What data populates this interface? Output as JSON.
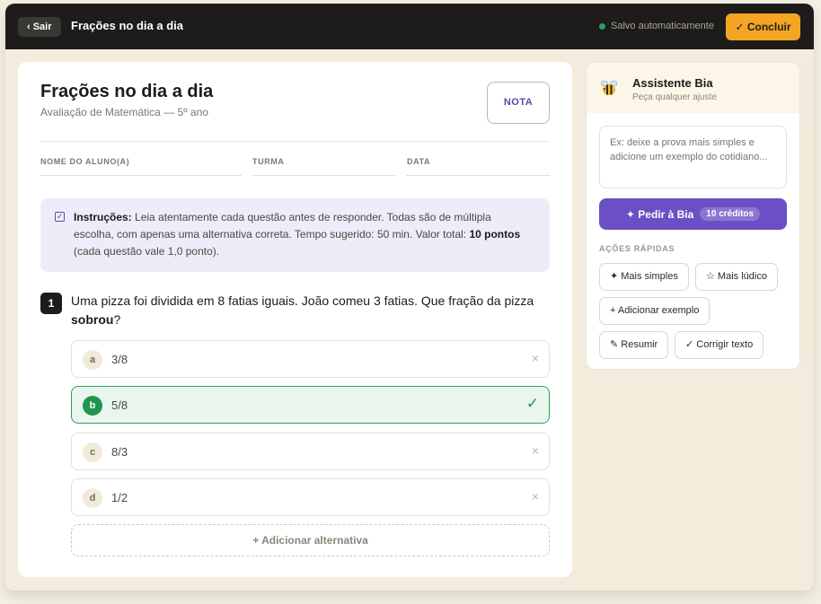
{
  "topbar": {
    "exit_label": "‹ Sair",
    "title": "Frações no dia a dia",
    "saved_status": "Salvo automaticamente",
    "finish_label": "✓ Concluir"
  },
  "document": {
    "title": "Frações no dia a dia",
    "subtitle": "Avaliação de Matemática — 5º ano",
    "grade_label": "NOTA",
    "fields": [
      "NOME DO ALUNO(A)",
      "TURMA",
      "DATA"
    ],
    "instructions": {
      "label": "Instruções:",
      "text": " Leia atentamente cada questão antes de responder. Todas são de múltipla escolha, com apenas uma alternativa correta. Tempo sugerido: 50 min. Valor total: ",
      "total": "10 pontos",
      "tail": " (cada questão vale 1,0 ponto)."
    },
    "question": {
      "number": "1",
      "text": "Uma pizza foi dividida em 8 fatias iguais. João comeu 3 fatias. Que fração da pizza ",
      "emphasis": "sobrou",
      "end": "?",
      "options": [
        {
          "letter": "a",
          "value": "3/8",
          "mark": "×"
        },
        {
          "letter": "b",
          "value": "5/8",
          "mark": "✓"
        },
        {
          "letter": "c",
          "value": "8/3",
          "mark": "×"
        },
        {
          "letter": "d",
          "value": "1/2",
          "mark": "×"
        }
      ],
      "correct_letter": "b",
      "add_option_label": "+ Adicionar alternativa"
    }
  },
  "assistant": {
    "name": "Assistente Bia",
    "subtitle": "Peça qualquer ajuste",
    "prompt_placeholder": "Ex: deixe a prova mais simples e adicione um exemplo do cotidiano...",
    "ask_label": "✦ Pedir à Bia",
    "credits": "10 créditos",
    "quick_title": "AÇÕES RÁPIDAS",
    "quick_actions": [
      "✦ Mais simples",
      "☆ Mais lúdico",
      "+ Adicionar exemplo",
      "✎ Resumir",
      "✓ Corrigir texto"
    ]
  },
  "colors": {
    "topbar": "#1d1c1a",
    "accent_orange": "#f5a524",
    "accent_purple": "#6b4fc4",
    "correct_green": "#22944f",
    "background": "#f3ecdc"
  }
}
